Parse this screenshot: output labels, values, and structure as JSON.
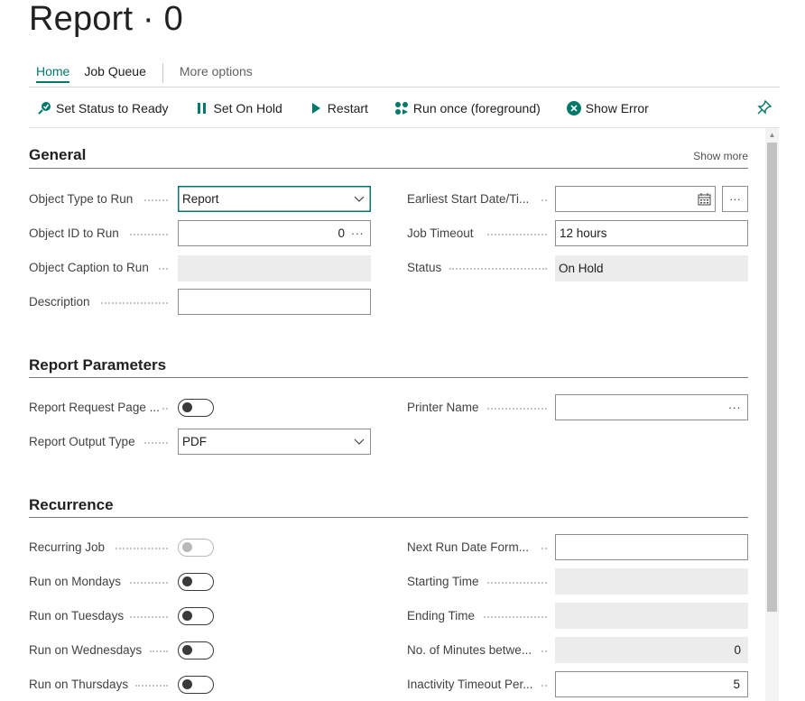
{
  "page": {
    "title": "Report · 0"
  },
  "menu": {
    "tabs": [
      {
        "label": "Home",
        "active": true
      },
      {
        "label": "Job Queue",
        "active": false
      }
    ],
    "more_options": "More options"
  },
  "actions": {
    "set_status_ready": "Set Status to Ready",
    "set_on_hold": "Set On Hold",
    "restart": "Restart",
    "run_once": "Run once (foreground)",
    "show_error": "Show Error"
  },
  "general": {
    "title": "General",
    "show_more": "Show more",
    "object_type_label": "Object Type to Run",
    "object_type_value": "Report",
    "object_id_label": "Object ID to Run",
    "object_id_value": "0",
    "object_caption_label": "Object Caption to Run",
    "object_caption_value": "",
    "description_label": "Description",
    "description_value": "",
    "earliest_start_label": "Earliest Start Date/Ti...",
    "earliest_start_value": "",
    "job_timeout_label": "Job Timeout",
    "job_timeout_value": "12 hours",
    "status_label": "Status",
    "status_value": "On Hold"
  },
  "report_parameters": {
    "title": "Report Parameters",
    "request_page_label": "Report Request Page ...",
    "output_type_label": "Report Output Type",
    "output_type_value": "PDF",
    "printer_name_label": "Printer Name",
    "printer_name_value": ""
  },
  "recurrence": {
    "title": "Recurrence",
    "recurring_job_label": "Recurring Job",
    "mondays_label": "Run on Mondays",
    "tuesdays_label": "Run on Tuesdays",
    "wednesdays_label": "Run on Wednesdays",
    "thursdays_label": "Run on Thursdays",
    "next_run_label": "Next Run Date Form...",
    "next_run_value": "",
    "starting_time_label": "Starting Time",
    "starting_time_value": "",
    "ending_time_label": "Ending Time",
    "ending_time_value": "",
    "minutes_between_label": "No. of Minutes betwe...",
    "minutes_between_value": "0",
    "inactivity_label": "Inactivity Timeout Per...",
    "inactivity_value": "5"
  },
  "colors": {
    "accent": "#00796b"
  },
  "icons": [
    "set-ready-icon",
    "pause-icon",
    "play-icon",
    "run-once-icon",
    "error-icon",
    "pin-icon",
    "calendar-icon",
    "chevron-down-icon",
    "ellipsis-icon"
  ]
}
